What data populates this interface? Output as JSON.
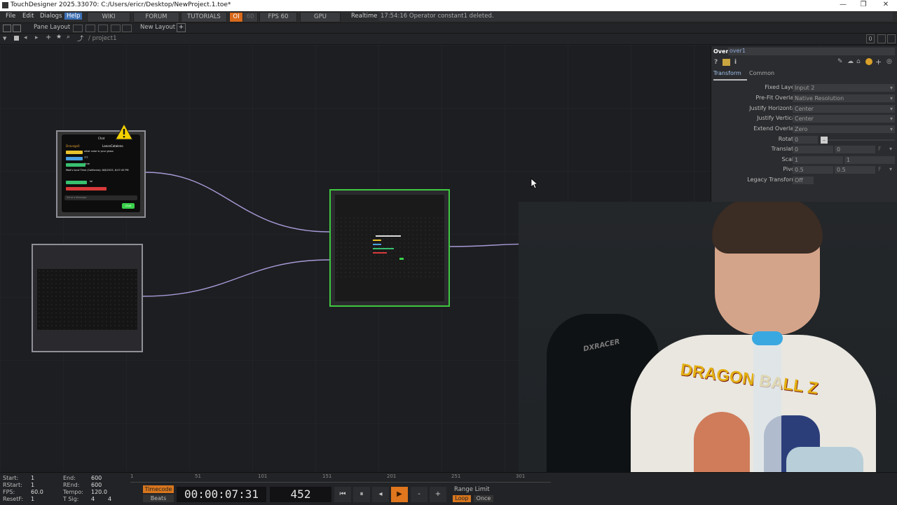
{
  "title": {
    "text": "TouchDesigner 2025.33070: C:/Users/ericr/Desktop/NewProject.1.toe*"
  },
  "window_controls": {
    "minimize": "—",
    "maximize": "❐",
    "close": "✕"
  },
  "menu": {
    "items": [
      "File",
      "Edit",
      "Dialogs",
      "Help"
    ],
    "wiki": "WIKI",
    "forum": "FORUM",
    "tutorials": "TUTORIALS",
    "oi": "OI",
    "sixty": "60",
    "fps": "FPS  60",
    "gpu": "GPU",
    "realtime": "Realtime",
    "status": "17:54:16 Operator constant1 deleted."
  },
  "layoutbar": {
    "pane_layout": "Pane Layout",
    "new_layout": "New Layout",
    "plus": "+",
    "zero": "0"
  },
  "pathbar": {
    "path": "/ project1"
  },
  "chat_node": {
    "title": "Chat",
    "user1": "Dravego0",
    "user2": "LanceCataleno",
    "line1": "what color is your grass",
    "line2": "???",
    "line3": "time",
    "line4": "Mad's local Time (California): 8/8/2025, 8:07:45 PM",
    "line5": "lol",
    "send_placeholder": "Send a Message",
    "chat_button": "Chat"
  },
  "params": {
    "op_type": "Over",
    "op_name": "over1",
    "tabs": [
      "Transform",
      "Common"
    ],
    "rows": [
      {
        "label": "Fixed Layer",
        "value": "Input 2"
      },
      {
        "label": "Pre-Fit Overlay",
        "value": "Native Resolution"
      },
      {
        "label": "Justify Horizontal",
        "value": "Center"
      },
      {
        "label": "Justify Vertical",
        "value": "Center"
      },
      {
        "label": "Extend Overlay",
        "value": "Zero"
      }
    ],
    "rotate_label": "Rotate",
    "rotate_value": "0",
    "translate_label": "Translate",
    "translate_x": "0",
    "translate_y": "0",
    "scale_label": "Scale",
    "scale_x": "1",
    "scale_y": "1",
    "pivot_label": "Pivot",
    "pivot_x": "0.5",
    "pivot_y": "0.5",
    "unit_flag": "F",
    "legacy_label": "Legacy Transform",
    "legacy_value": "Off"
  },
  "timeline": {
    "start_label": "Start:",
    "start": "1",
    "end_label": "End:",
    "end": "600",
    "rstart_label": "RStart:",
    "rstart": "1",
    "rend_label": "REnd:",
    "rend": "600",
    "fps_label": "FPS:",
    "fps": "60.0",
    "tempo_label": "Tempo:",
    "tempo": "120.0",
    "resetf_label": "ResetF:",
    "resetf": "1",
    "tsig_label": "T Sig:",
    "tsig1": "4",
    "tsig2": "4",
    "ticks": [
      "1",
      "51",
      "101",
      "151",
      "201",
      "251",
      "301"
    ],
    "timecode_label": "Timecode",
    "beats_label": "Beats",
    "timecode": "00:00:07:31",
    "frame": "452",
    "range_limit": "Range Limit",
    "loop": "Loop",
    "once": "Once"
  },
  "webcam": {
    "shirt_text": "DRAGON BALL Z",
    "chair_brand": "DXRACER"
  },
  "colors": {
    "accent": "#3c6fb4",
    "selected_node": "#3fc73f",
    "wire": "#a89ad8",
    "play_button": "#e0761d"
  }
}
